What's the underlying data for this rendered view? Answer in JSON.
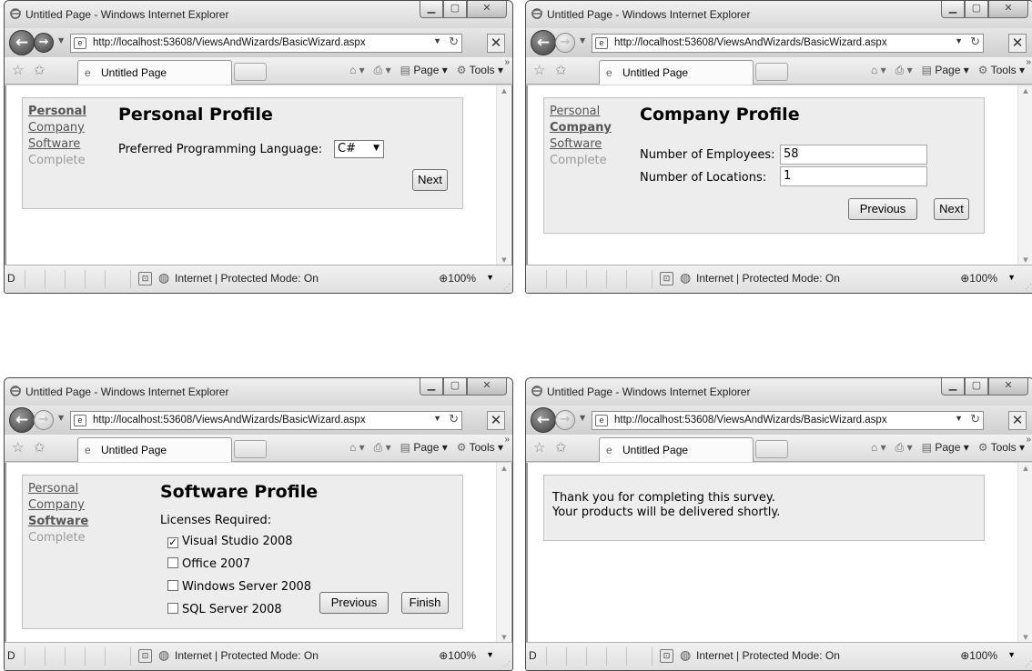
{
  "windows": [
    {
      "title": "Untitled Page - Windows Internet Explorer",
      "url": "http://localhost:53608/ViewsAndWizards/BasicWizard.aspx",
      "tab_label": "Untitled Page",
      "commands": {
        "page": "Page",
        "tools": "Tools"
      },
      "status": {
        "left": "D",
        "zone": "Internet | Protected Mode: On",
        "zoom": "100%"
      },
      "wizard": {
        "sidebar": [
          "Personal",
          "Company",
          "Software",
          "Complete"
        ],
        "title": "Personal Profile",
        "language_label": "Preferred Programming Language:",
        "language_value": "C#",
        "next_button": "Next"
      }
    },
    {
      "title": "Untitled Page - Windows Internet Explorer",
      "url": "http://localhost:53608/ViewsAndWizards/BasicWizard.aspx",
      "tab_label": "Untitled Page",
      "commands": {
        "page": "Page",
        "tools": "Tools"
      },
      "status": {
        "zone": "Internet | Protected Mode: On",
        "zoom": "100%"
      },
      "wizard": {
        "sidebar": [
          "Personal",
          "Company",
          "Software",
          "Complete"
        ],
        "title": "Company Profile",
        "employees_label": "Number of Employees:",
        "employees_value": "58",
        "locations_label": "Number of Locations:",
        "locations_value": "1",
        "previous_button": "Previous",
        "next_button": "Next"
      }
    },
    {
      "title": "Untitled Page - Windows Internet Explorer",
      "url": "http://localhost:53608/ViewsAndWizards/BasicWizard.aspx",
      "tab_label": "Untitled Page",
      "commands": {
        "page": "Page",
        "tools": "Tools"
      },
      "status": {
        "left": "D",
        "zone": "Internet | Protected Mode: On",
        "zoom": "100%"
      },
      "wizard": {
        "sidebar": [
          "Personal",
          "Company",
          "Software",
          "Complete"
        ],
        "title": "Software Profile",
        "licenses_label": "Licenses Required:",
        "licenses": [
          {
            "label": "Visual Studio 2008",
            "checked": true
          },
          {
            "label": "Office 2007",
            "checked": false
          },
          {
            "label": "Windows Server 2008",
            "checked": false
          },
          {
            "label": "SQL Server 2008",
            "checked": false
          }
        ],
        "previous_button": "Previous",
        "finish_button": "Finish"
      }
    },
    {
      "title": "Untitled Page - Windows Internet Explorer",
      "url": "http://localhost:53608/ViewsAndWizards/BasicWizard.aspx",
      "tab_label": "Untitled Page",
      "commands": {
        "page": "Page",
        "tools": "Tools"
      },
      "status": {
        "left": "D",
        "zone": "Internet | Protected Mode: On",
        "zoom": "100%"
      },
      "complete": {
        "line1": "Thank you for completing this survey.",
        "line2": "Your products will be delivered shortly."
      }
    }
  ]
}
